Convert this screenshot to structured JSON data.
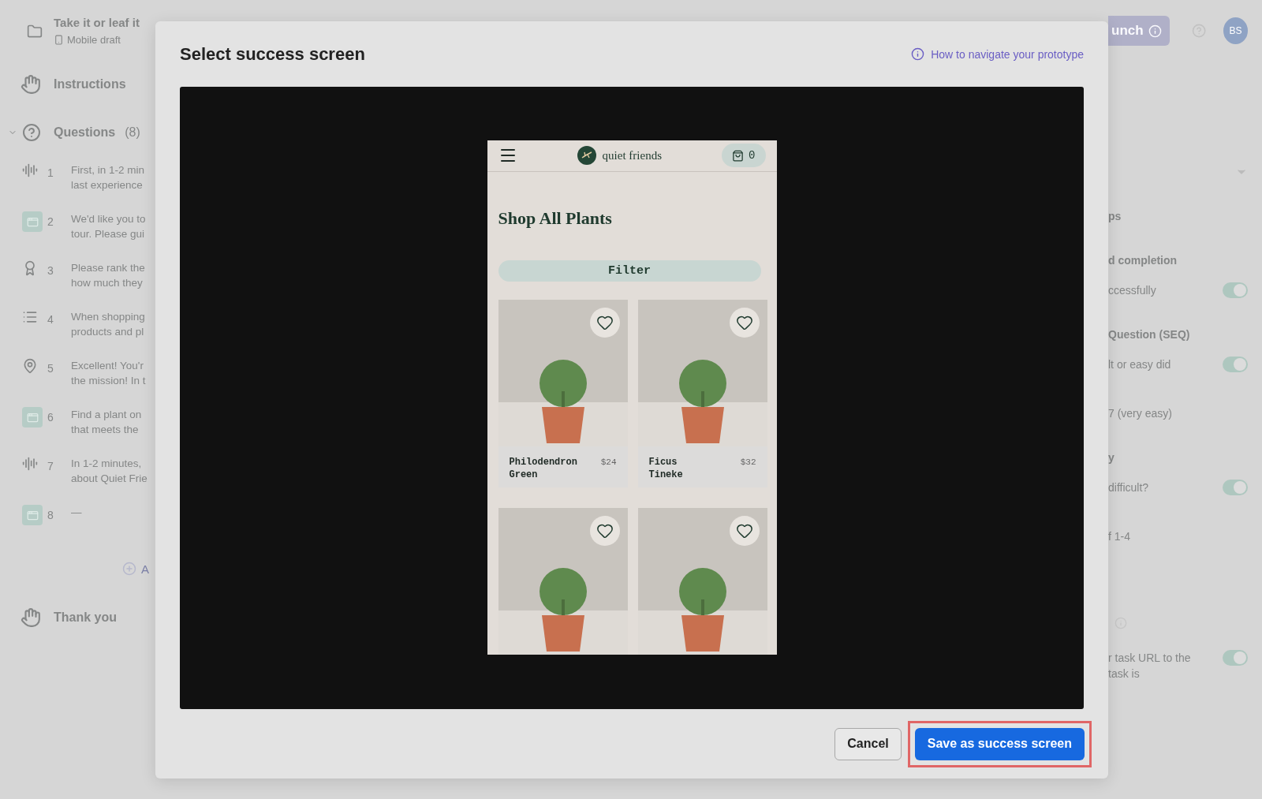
{
  "header": {
    "title": "Take it or leaf it",
    "subtitle": "Mobile draft",
    "launch": "unch",
    "avatar": "BS"
  },
  "sidebar": {
    "instructions": "Instructions",
    "questions_label": "Questions",
    "questions_count": "(8)",
    "expanded": true,
    "questions": [
      {
        "number": "1",
        "kind": "audio",
        "lines": [
          "First, in 1-2 min",
          "last experience"
        ]
      },
      {
        "number": "2",
        "kind": "task",
        "lines": [
          "We'd like you to",
          "tour. Please gui"
        ]
      },
      {
        "number": "3",
        "kind": "rank",
        "lines": [
          "Please rank the",
          "how much they"
        ]
      },
      {
        "number": "4",
        "kind": "list",
        "lines": [
          "When shopping",
          "products and pl"
        ]
      },
      {
        "number": "5",
        "kind": "pin",
        "lines": [
          "Excellent! You'r",
          "the mission! In t"
        ]
      },
      {
        "number": "6",
        "kind": "task",
        "lines": [
          "Find a plant on",
          "that meets the"
        ]
      },
      {
        "number": "7",
        "kind": "audio",
        "lines": [
          "In 1-2 minutes,",
          "about Quiet Frie"
        ]
      },
      {
        "number": "8",
        "kind": "task",
        "lines": [
          "—"
        ]
      }
    ],
    "add": "A",
    "thank_you": "Thank you"
  },
  "right_panel": [
    {
      "kind": "dropdown"
    },
    {
      "kind": "heading",
      "text": "ps"
    },
    {
      "kind": "heading",
      "text": "d completion"
    },
    {
      "kind": "toggle",
      "text": "ccessfully",
      "on": true
    },
    {
      "kind": "heading",
      "text": "Question (SEQ)"
    },
    {
      "kind": "toggle",
      "text": "lt or easy did",
      "on": true
    },
    {
      "kind": "text",
      "text": "7 (very easy)"
    },
    {
      "kind": "heading",
      "text": "y"
    },
    {
      "kind": "toggle",
      "text": "difficult?",
      "on": true
    },
    {
      "kind": "text",
      "text": "f 1-4"
    },
    {
      "kind": "info"
    },
    {
      "kind": "toggle",
      "text": "r task URL to the",
      "text2": "task is",
      "on": true
    }
  ],
  "modal": {
    "title": "Select success screen",
    "help_link": "How to navigate your prototype",
    "prototype": {
      "brand": "quiet friends",
      "cart_count": "0",
      "heading": "Shop All Plants",
      "filter": "Filter",
      "products": [
        {
          "kind": "labeled",
          "name_lines": [
            "Philodendron",
            "Green"
          ],
          "price": "$24"
        },
        {
          "kind": "labeled",
          "name_lines": [
            "Ficus",
            "Tineke"
          ],
          "price": "$32"
        },
        {
          "kind": "image"
        },
        {
          "kind": "image"
        }
      ]
    },
    "cancel": "Cancel",
    "save": "Save as success screen",
    "save_highlighted": true
  }
}
